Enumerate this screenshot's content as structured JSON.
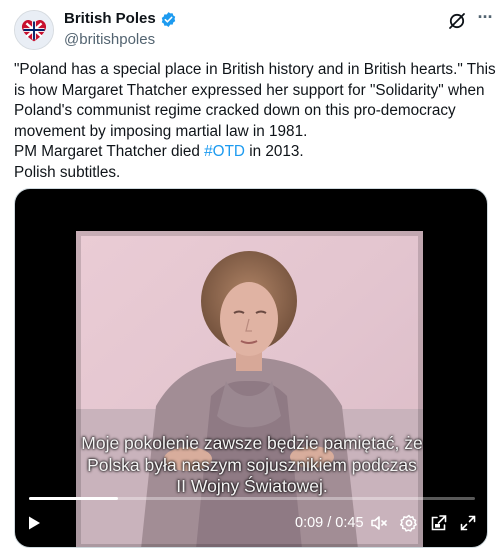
{
  "account": {
    "name": "British Poles",
    "handle": "@britishpoles"
  },
  "tweet": {
    "quote": "\"Poland has a special place in British history and in British hearts.\" This is how Margaret Thatcher expressed her support for \"Solidarity\" when Poland's communist regime cracked down on this pro-democracy movement by imposing martial law in 1981.",
    "line2_before": "PM Margaret Thatcher died ",
    "hashtag": "#OTD",
    "line2_after": " in  2013.",
    "line3": "Polish subtitles."
  },
  "video": {
    "subtitles": [
      "Moje pokolenie zawsze będzie pamiętać, że",
      "Polska była naszym sojusznikiem podczas",
      "II Wojny Światowej."
    ],
    "time_display": "0:09 / 0:45",
    "progress": 0.2
  },
  "icons": {
    "verified": "verified-badge-icon",
    "grok": "grok-icon",
    "more": "more-icon",
    "play": "play-icon",
    "volume": "volume-muted-icon",
    "settings": "gear-icon",
    "pip": "picture-in-picture-icon",
    "fullscreen": "fullscreen-icon"
  },
  "colors": {
    "link": "#1d9bf0",
    "verified": "#1d9bf0",
    "text": "#0f1419",
    "secondary": "#536471"
  }
}
